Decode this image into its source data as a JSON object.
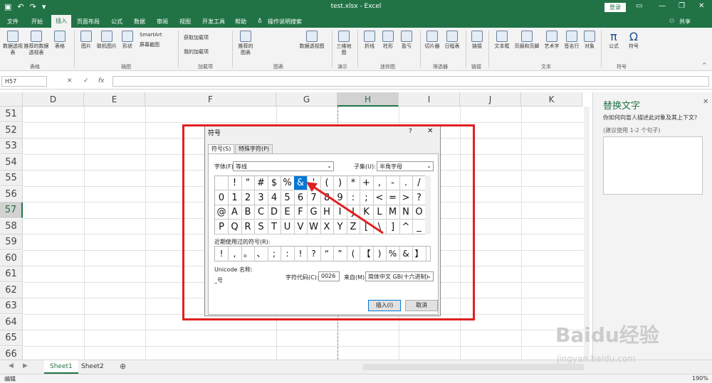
{
  "titlebar": {
    "document_title": "test.xlsx  -  Excel",
    "login": "登录",
    "share": "共享"
  },
  "menu": [
    "文件",
    "开始",
    "插入",
    "页面布局",
    "公式",
    "数据",
    "审阅",
    "视图",
    "开发工具",
    "帮助",
    "操作说明搜索"
  ],
  "ribbon": {
    "buttons": [
      "数据透视表",
      "推荐的数据透视表",
      "表格",
      "图片",
      "联机图片",
      "形状",
      "SmartArt",
      "屏幕截图",
      "获取加载项",
      "我的加载项",
      "推荐的图表",
      "数据透视图",
      "三维地图",
      "折线",
      "柱形",
      "盈亏",
      "切片器",
      "日程表",
      "链接",
      "文本框",
      "页眉和页脚",
      "艺术字",
      "签名行",
      "对象",
      "公式",
      "符号"
    ],
    "groups": [
      "表格",
      "插图",
      "加载项",
      "图表",
      "演示",
      "迷你图",
      "筛选器",
      "链接",
      "文本",
      "符号"
    ]
  },
  "formula": {
    "namebox": "H57",
    "cancel": "✕",
    "confirm": "✓",
    "fx": "fx"
  },
  "columns": [
    "D",
    "E",
    "F",
    "G",
    "H",
    "I",
    "J",
    "K"
  ],
  "rows": [
    "51",
    "52",
    "53",
    "54",
    "55",
    "56",
    "57",
    "58",
    "59",
    "60",
    "61",
    "62",
    "63",
    "64",
    "65",
    "66"
  ],
  "pane": {
    "title": "替换文字",
    "question": "你如何向盲人描述此对象及其上下文?",
    "hint": "(建议使用 1-2 个句子)"
  },
  "sheets": [
    "Sheet1",
    "Sheet2"
  ],
  "status": {
    "mode": "编辑",
    "zoom": "190%"
  },
  "dialog": {
    "title": "符号",
    "help": "?",
    "tab_symbols": "符号(S)",
    "tab_special": "特殊字符(P)",
    "font_label": "字体(F):",
    "font_value": "等线",
    "subset_label": "子集(U):",
    "subset_value": "半角字母",
    "symbols": [
      [
        "",
        "!",
        "\"",
        "#",
        "$",
        "%",
        "&",
        "'",
        "(",
        ")",
        "*",
        "+",
        ",",
        "-",
        ".",
        "/"
      ],
      [
        "0",
        "1",
        "2",
        "3",
        "4",
        "5",
        "6",
        "7",
        "8",
        "9",
        ":",
        ";",
        "<",
        "=",
        ">",
        "?"
      ],
      [
        "@",
        "A",
        "B",
        "C",
        "D",
        "E",
        "F",
        "G",
        "H",
        "I",
        "J",
        "K",
        "L",
        "M",
        "N",
        "O"
      ],
      [
        "P",
        "Q",
        "R",
        "S",
        "T",
        "U",
        "V",
        "W",
        "X",
        "Y",
        "Z",
        "[",
        "\\",
        "]",
        "^",
        "_"
      ]
    ],
    "selected_symbol": "&",
    "recent_label": "近期使用过的符号(R):",
    "recent": [
      "!",
      ",",
      "。",
      "、",
      ";",
      ":",
      "!",
      "?",
      "“",
      "”",
      "(",
      "【",
      ")",
      "%",
      "&",
      "】"
    ],
    "unicode_label": "Unicode 名称:",
    "unicode_name": "_号",
    "code_label": "字符代码(C):",
    "code_value": "0026",
    "from_label": "来自(M):",
    "from_value": "简体中文 GB(十六进制)",
    "insert": "插入(I)",
    "cancel": "取消"
  },
  "watermark": {
    "brand": "Baidu经验",
    "url": "jingyan.baidu.com"
  },
  "colors": {
    "excel_green": "#217346",
    "highlight": "#e02020",
    "selection": "#0078d7"
  }
}
